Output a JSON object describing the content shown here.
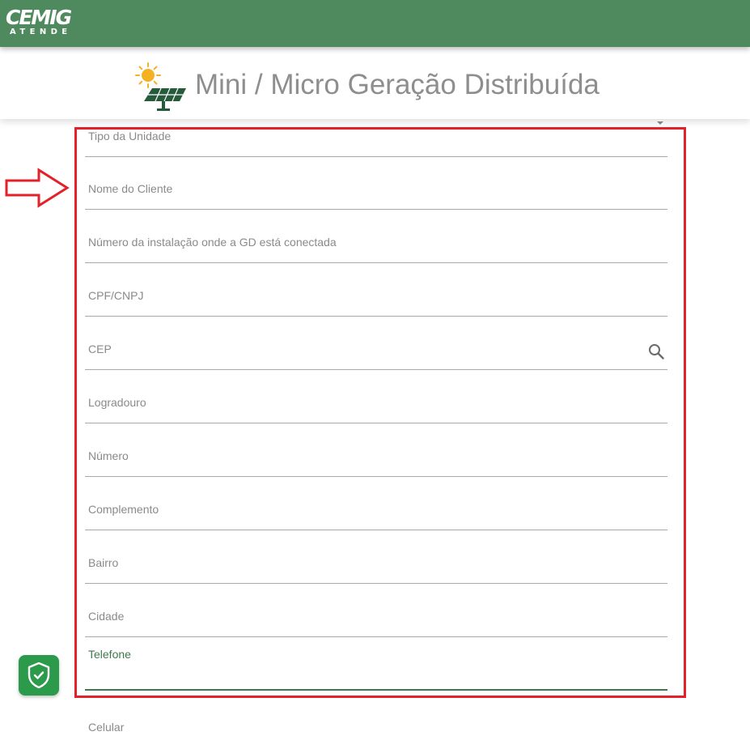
{
  "app": {
    "logo_main": "CEMIG",
    "logo_sub": "ATENDE"
  },
  "header": {
    "title": "Mini / Micro Geração Distribuída",
    "icon": "solar-panel-icon"
  },
  "form": {
    "fields": [
      {
        "label": "Tipo da Unidade",
        "type": "select",
        "value": ""
      },
      {
        "label": "Nome do Cliente",
        "type": "text",
        "value": ""
      },
      {
        "label": "Número da instalação onde a GD está conectada",
        "type": "text",
        "value": ""
      },
      {
        "label": "CPF/CNPJ",
        "type": "text",
        "value": ""
      },
      {
        "label": "CEP",
        "type": "text",
        "value": "",
        "icon": "search-icon"
      },
      {
        "label": "Logradouro",
        "type": "text",
        "value": ""
      },
      {
        "label": "Número",
        "type": "text",
        "value": ""
      },
      {
        "label": "Complemento",
        "type": "text",
        "value": ""
      },
      {
        "label": "Bairro",
        "type": "text",
        "value": ""
      },
      {
        "label": "Cidade",
        "type": "text",
        "value": ""
      },
      {
        "label": "Telefone",
        "type": "text",
        "value": "",
        "state": "focused"
      },
      {
        "label": "Celular",
        "type": "text",
        "value": ""
      }
    ]
  },
  "overlay": {
    "highlight_color": "#e32129",
    "pointer": "right-arrow-icon"
  },
  "floating": {
    "shield_icon": "shield-check-icon"
  },
  "colors": {
    "brand": "#4f8a5f",
    "focus": "#3f7a4e",
    "shield_button": "#2b9a4a"
  }
}
